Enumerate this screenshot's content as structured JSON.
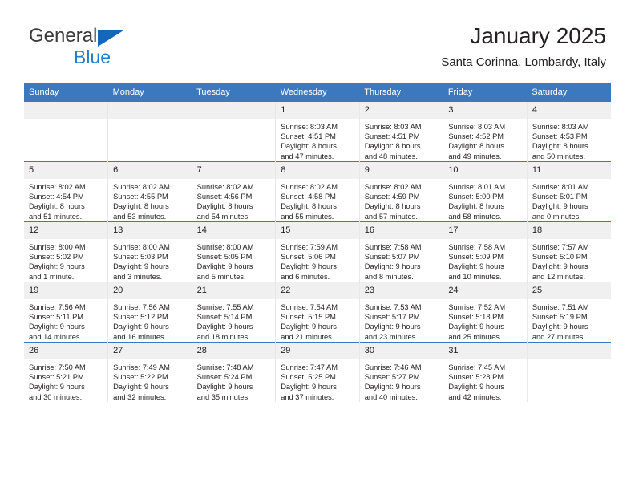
{
  "brand": {
    "name_part1": "General",
    "name_part2": "Blue",
    "triangle_icon": "blue-triangle-icon",
    "accent_color": "#1f7fd1",
    "header_color": "#3b78be"
  },
  "header": {
    "title": "January 2025",
    "subtitle": "Santa Corinna, Lombardy, Italy"
  },
  "weekday_headers": [
    "Sunday",
    "Monday",
    "Tuesday",
    "Wednesday",
    "Thursday",
    "Friday",
    "Saturday"
  ],
  "weeks": [
    [
      {
        "day": "",
        "empty": true,
        "sunrise": "",
        "sunset": "",
        "daylight_line1": "",
        "daylight_line2": ""
      },
      {
        "day": "",
        "empty": true,
        "sunrise": "",
        "sunset": "",
        "daylight_line1": "",
        "daylight_line2": ""
      },
      {
        "day": "",
        "empty": true,
        "sunrise": "",
        "sunset": "",
        "daylight_line1": "",
        "daylight_line2": ""
      },
      {
        "day": "1",
        "empty": false,
        "sunrise": "Sunrise: 8:03 AM",
        "sunset": "Sunset: 4:51 PM",
        "daylight_line1": "Daylight: 8 hours",
        "daylight_line2": "and 47 minutes."
      },
      {
        "day": "2",
        "empty": false,
        "sunrise": "Sunrise: 8:03 AM",
        "sunset": "Sunset: 4:51 PM",
        "daylight_line1": "Daylight: 8 hours",
        "daylight_line2": "and 48 minutes."
      },
      {
        "day": "3",
        "empty": false,
        "sunrise": "Sunrise: 8:03 AM",
        "sunset": "Sunset: 4:52 PM",
        "daylight_line1": "Daylight: 8 hours",
        "daylight_line2": "and 49 minutes."
      },
      {
        "day": "4",
        "empty": false,
        "sunrise": "Sunrise: 8:03 AM",
        "sunset": "Sunset: 4:53 PM",
        "daylight_line1": "Daylight: 8 hours",
        "daylight_line2": "and 50 minutes."
      }
    ],
    [
      {
        "day": "5",
        "empty": false,
        "sunrise": "Sunrise: 8:02 AM",
        "sunset": "Sunset: 4:54 PM",
        "daylight_line1": "Daylight: 8 hours",
        "daylight_line2": "and 51 minutes."
      },
      {
        "day": "6",
        "empty": false,
        "sunrise": "Sunrise: 8:02 AM",
        "sunset": "Sunset: 4:55 PM",
        "daylight_line1": "Daylight: 8 hours",
        "daylight_line2": "and 53 minutes."
      },
      {
        "day": "7",
        "empty": false,
        "sunrise": "Sunrise: 8:02 AM",
        "sunset": "Sunset: 4:56 PM",
        "daylight_line1": "Daylight: 8 hours",
        "daylight_line2": "and 54 minutes."
      },
      {
        "day": "8",
        "empty": false,
        "sunrise": "Sunrise: 8:02 AM",
        "sunset": "Sunset: 4:58 PM",
        "daylight_line1": "Daylight: 8 hours",
        "daylight_line2": "and 55 minutes."
      },
      {
        "day": "9",
        "empty": false,
        "sunrise": "Sunrise: 8:02 AM",
        "sunset": "Sunset: 4:59 PM",
        "daylight_line1": "Daylight: 8 hours",
        "daylight_line2": "and 57 minutes."
      },
      {
        "day": "10",
        "empty": false,
        "sunrise": "Sunrise: 8:01 AM",
        "sunset": "Sunset: 5:00 PM",
        "daylight_line1": "Daylight: 8 hours",
        "daylight_line2": "and 58 minutes."
      },
      {
        "day": "11",
        "empty": false,
        "sunrise": "Sunrise: 8:01 AM",
        "sunset": "Sunset: 5:01 PM",
        "daylight_line1": "Daylight: 9 hours",
        "daylight_line2": "and 0 minutes."
      }
    ],
    [
      {
        "day": "12",
        "empty": false,
        "sunrise": "Sunrise: 8:00 AM",
        "sunset": "Sunset: 5:02 PM",
        "daylight_line1": "Daylight: 9 hours",
        "daylight_line2": "and 1 minute."
      },
      {
        "day": "13",
        "empty": false,
        "sunrise": "Sunrise: 8:00 AM",
        "sunset": "Sunset: 5:03 PM",
        "daylight_line1": "Daylight: 9 hours",
        "daylight_line2": "and 3 minutes."
      },
      {
        "day": "14",
        "empty": false,
        "sunrise": "Sunrise: 8:00 AM",
        "sunset": "Sunset: 5:05 PM",
        "daylight_line1": "Daylight: 9 hours",
        "daylight_line2": "and 5 minutes."
      },
      {
        "day": "15",
        "empty": false,
        "sunrise": "Sunrise: 7:59 AM",
        "sunset": "Sunset: 5:06 PM",
        "daylight_line1": "Daylight: 9 hours",
        "daylight_line2": "and 6 minutes."
      },
      {
        "day": "16",
        "empty": false,
        "sunrise": "Sunrise: 7:58 AM",
        "sunset": "Sunset: 5:07 PM",
        "daylight_line1": "Daylight: 9 hours",
        "daylight_line2": "and 8 minutes."
      },
      {
        "day": "17",
        "empty": false,
        "sunrise": "Sunrise: 7:58 AM",
        "sunset": "Sunset: 5:09 PM",
        "daylight_line1": "Daylight: 9 hours",
        "daylight_line2": "and 10 minutes."
      },
      {
        "day": "18",
        "empty": false,
        "sunrise": "Sunrise: 7:57 AM",
        "sunset": "Sunset: 5:10 PM",
        "daylight_line1": "Daylight: 9 hours",
        "daylight_line2": "and 12 minutes."
      }
    ],
    [
      {
        "day": "19",
        "empty": false,
        "sunrise": "Sunrise: 7:56 AM",
        "sunset": "Sunset: 5:11 PM",
        "daylight_line1": "Daylight: 9 hours",
        "daylight_line2": "and 14 minutes."
      },
      {
        "day": "20",
        "empty": false,
        "sunrise": "Sunrise: 7:56 AM",
        "sunset": "Sunset: 5:12 PM",
        "daylight_line1": "Daylight: 9 hours",
        "daylight_line2": "and 16 minutes."
      },
      {
        "day": "21",
        "empty": false,
        "sunrise": "Sunrise: 7:55 AM",
        "sunset": "Sunset: 5:14 PM",
        "daylight_line1": "Daylight: 9 hours",
        "daylight_line2": "and 18 minutes."
      },
      {
        "day": "22",
        "empty": false,
        "sunrise": "Sunrise: 7:54 AM",
        "sunset": "Sunset: 5:15 PM",
        "daylight_line1": "Daylight: 9 hours",
        "daylight_line2": "and 21 minutes."
      },
      {
        "day": "23",
        "empty": false,
        "sunrise": "Sunrise: 7:53 AM",
        "sunset": "Sunset: 5:17 PM",
        "daylight_line1": "Daylight: 9 hours",
        "daylight_line2": "and 23 minutes."
      },
      {
        "day": "24",
        "empty": false,
        "sunrise": "Sunrise: 7:52 AM",
        "sunset": "Sunset: 5:18 PM",
        "daylight_line1": "Daylight: 9 hours",
        "daylight_line2": "and 25 minutes."
      },
      {
        "day": "25",
        "empty": false,
        "sunrise": "Sunrise: 7:51 AM",
        "sunset": "Sunset: 5:19 PM",
        "daylight_line1": "Daylight: 9 hours",
        "daylight_line2": "and 27 minutes."
      }
    ],
    [
      {
        "day": "26",
        "empty": false,
        "sunrise": "Sunrise: 7:50 AM",
        "sunset": "Sunset: 5:21 PM",
        "daylight_line1": "Daylight: 9 hours",
        "daylight_line2": "and 30 minutes."
      },
      {
        "day": "27",
        "empty": false,
        "sunrise": "Sunrise: 7:49 AM",
        "sunset": "Sunset: 5:22 PM",
        "daylight_line1": "Daylight: 9 hours",
        "daylight_line2": "and 32 minutes."
      },
      {
        "day": "28",
        "empty": false,
        "sunrise": "Sunrise: 7:48 AM",
        "sunset": "Sunset: 5:24 PM",
        "daylight_line1": "Daylight: 9 hours",
        "daylight_line2": "and 35 minutes."
      },
      {
        "day": "29",
        "empty": false,
        "sunrise": "Sunrise: 7:47 AM",
        "sunset": "Sunset: 5:25 PM",
        "daylight_line1": "Daylight: 9 hours",
        "daylight_line2": "and 37 minutes."
      },
      {
        "day": "30",
        "empty": false,
        "sunrise": "Sunrise: 7:46 AM",
        "sunset": "Sunset: 5:27 PM",
        "daylight_line1": "Daylight: 9 hours",
        "daylight_line2": "and 40 minutes."
      },
      {
        "day": "31",
        "empty": false,
        "sunrise": "Sunrise: 7:45 AM",
        "sunset": "Sunset: 5:28 PM",
        "daylight_line1": "Daylight: 9 hours",
        "daylight_line2": "and 42 minutes."
      },
      {
        "day": "",
        "empty": true,
        "sunrise": "",
        "sunset": "",
        "daylight_line1": "",
        "daylight_line2": ""
      }
    ]
  ]
}
